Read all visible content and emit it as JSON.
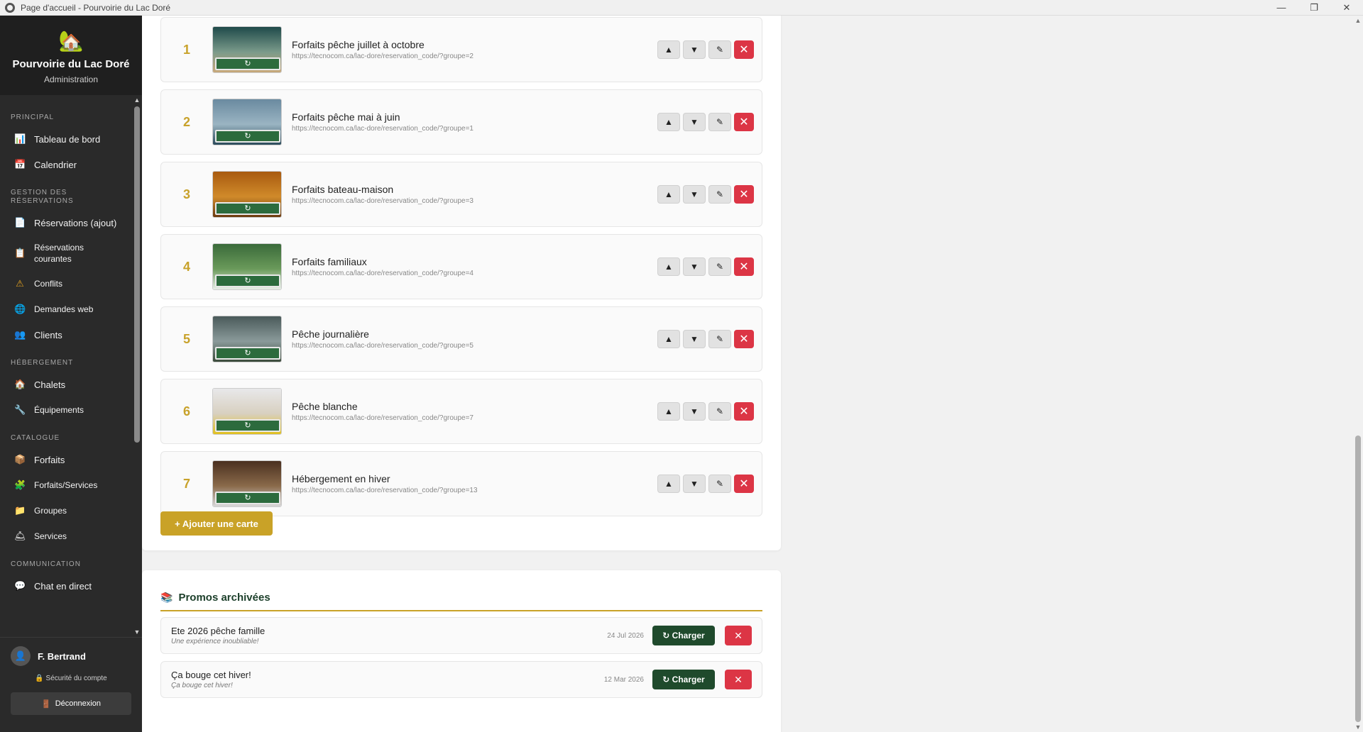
{
  "window": {
    "title": "Page d'accueil - Pourvoirie du Lac Doré"
  },
  "brand": {
    "name": "Pourvoirie du Lac Doré",
    "subtitle": "Administration",
    "logo_icon": "house-icon"
  },
  "nav": {
    "sections": [
      {
        "label": "PRINCIPAL",
        "items": [
          {
            "label": "Tableau de bord",
            "icon": "chart-icon"
          },
          {
            "label": "Calendrier",
            "icon": "calendar-icon"
          }
        ]
      },
      {
        "label": "GESTION DES RÉSERVATIONS",
        "items": [
          {
            "label": "Réservations (ajout)",
            "icon": "document-icon"
          },
          {
            "label": "Réservations courantes",
            "icon": "clipboard-icon"
          },
          {
            "label": "Conflits",
            "icon": "warning-icon"
          },
          {
            "label": "Demandes web",
            "icon": "globe-icon"
          },
          {
            "label": "Clients",
            "icon": "people-icon"
          }
        ]
      },
      {
        "label": "HÉBERGEMENT",
        "items": [
          {
            "label": "Chalets",
            "icon": "cabin-icon"
          },
          {
            "label": "Équipements",
            "icon": "wrench-icon"
          }
        ]
      },
      {
        "label": "CATALOGUE",
        "items": [
          {
            "label": "Forfaits",
            "icon": "package-icon"
          },
          {
            "label": "Forfaits/Services",
            "icon": "puzzle-icon"
          },
          {
            "label": "Groupes",
            "icon": "folder-icon"
          },
          {
            "label": "Services",
            "icon": "bell-icon"
          }
        ]
      },
      {
        "label": "COMMUNICATION",
        "items": [
          {
            "label": "Chat en direct",
            "icon": "chat-icon"
          }
        ]
      }
    ]
  },
  "user": {
    "name": "F. Bertrand",
    "security_label": "Sécurité du compte",
    "logout_label": "Déconnexion"
  },
  "cards": [
    {
      "num": "1",
      "title": "Forfaits pêche juillet à octobre",
      "url": "https://tecnocom.ca/lac-dore/reservation_code/?groupe=2",
      "colors": [
        "#1f4a4a",
        "#7a9a8a",
        "#c8a87a"
      ]
    },
    {
      "num": "2",
      "title": "Forfaits pêche mai à juin",
      "url": "https://tecnocom.ca/lac-dore/reservation_code/?groupe=1",
      "colors": [
        "#6a8aa0",
        "#9ab4c2",
        "#2a4a5a"
      ]
    },
    {
      "num": "3",
      "title": "Forfaits bateau-maison",
      "url": "https://tecnocom.ca/lac-dore/reservation_code/?groupe=3",
      "colors": [
        "#a85a10",
        "#d08a2a",
        "#6a3a10"
      ]
    },
    {
      "num": "4",
      "title": "Forfaits familiaux",
      "url": "https://tecnocom.ca/lac-dore/reservation_code/?groupe=4",
      "colors": [
        "#3a6a3a",
        "#6a9a5a",
        "#e8efe8"
      ]
    },
    {
      "num": "5",
      "title": "Pêche journalière",
      "url": "https://tecnocom.ca/lac-dore/reservation_code/?groupe=5",
      "colors": [
        "#4a5a5a",
        "#8a9a9a",
        "#3a4a3a"
      ]
    },
    {
      "num": "6",
      "title": "Pêche blanche",
      "url": "https://tecnocom.ca/lac-dore/reservation_code/?groupe=7",
      "colors": [
        "#e8e8ea",
        "#d8d0c0",
        "#e0c020"
      ]
    },
    {
      "num": "7",
      "title": "Hébergement en hiver",
      "url": "https://tecnocom.ca/lac-dore/reservation_code/?groupe=13",
      "colors": [
        "#4a3020",
        "#8a6a4a",
        "#d8d8d8"
      ]
    }
  ],
  "row_labels": {
    "up": "▲",
    "down": "▼",
    "edit": "✎",
    "delete": "✕",
    "refresh": "↻"
  },
  "add_card_label": "+ Ajouter une carte",
  "promos": {
    "title": "Promos archivées",
    "charger_label": "↻ Charger",
    "delete_label": "✕",
    "items": [
      {
        "name": "Ete 2026 pêche famille",
        "subtitle": "Une expérience inoubliable!",
        "date": "24 Jul 2026"
      },
      {
        "name": "Ça bouge cet hiver!",
        "subtitle": "Ça bouge cet hiver!",
        "date": "12 Mar 2026"
      }
    ]
  },
  "colors": {
    "accent_gold": "#c9a227",
    "dark_green": "#1f4a2c",
    "danger": "#dc3545",
    "sidebar_bg": "#2a2a2a"
  }
}
